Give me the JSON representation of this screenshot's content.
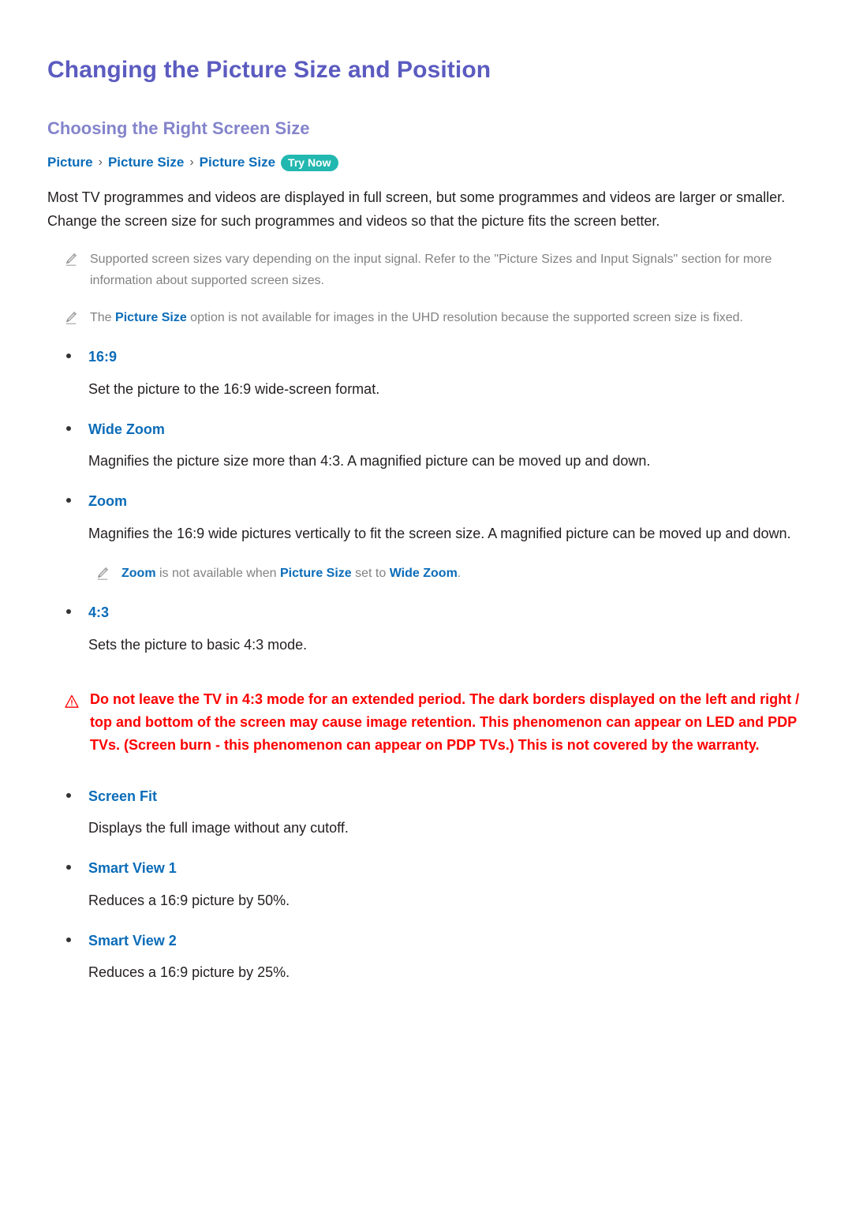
{
  "colors": {
    "title": "#5b5bc0",
    "section_title": "#8484cc",
    "link_blue": "#0b6cb8",
    "try_now_badge": "#22b8b0",
    "note_grey": "#828282",
    "caution_red": "#fe0000",
    "body_text": "#231f20"
  },
  "document": {
    "title": "Changing the Picture Size and Position",
    "section_title": "Choosing the Right Screen Size"
  },
  "breadcrumb": {
    "items": [
      "Picture",
      "Picture Size",
      "Picture Size"
    ],
    "separator": "›",
    "badge": "Try Now"
  },
  "intro": "Most TV programmes and videos are displayed in full screen, but some programmes and videos are larger or smaller. Change the screen size for such programmes and videos so that the picture fits the screen better.",
  "notes": [
    {
      "icon": "pencil-icon",
      "parts": [
        {
          "text": "Supported screen sizes vary depending on the input signal. Refer to the \"Picture Sizes and Input Signals\" section for more information about supported screen sizes.",
          "highlight": false
        }
      ]
    },
    {
      "icon": "pencil-icon",
      "parts": [
        {
          "text": "The ",
          "highlight": false
        },
        {
          "text": "Picture Size",
          "highlight": true
        },
        {
          "text": " option is not available for images in the UHD resolution because the supported screen size is fixed.",
          "highlight": false
        }
      ]
    }
  ],
  "options": [
    {
      "label": "16:9",
      "description": "Set the picture to the 16:9 wide-screen format."
    },
    {
      "label": "Wide Zoom",
      "description": "Magnifies the picture size more than 4:3. A magnified picture can be moved up and down."
    },
    {
      "label": "Zoom",
      "description": "Magnifies the 16:9 wide pictures vertically to fit the screen size. A magnified picture can be moved up and down.",
      "nested_note": {
        "icon": "pencil-icon",
        "parts": [
          {
            "text": "Zoom",
            "highlight": true
          },
          {
            "text": " is not available when ",
            "highlight": false
          },
          {
            "text": "Picture Size",
            "highlight": true
          },
          {
            "text": " set to ",
            "highlight": false
          },
          {
            "text": "Wide Zoom",
            "highlight": true
          },
          {
            "text": ".",
            "highlight": false
          }
        ]
      }
    },
    {
      "label": "4:3",
      "description": "Sets the picture to basic 4:3 mode."
    }
  ],
  "caution": {
    "icon": "warning-triangle-icon",
    "text": "Do not leave the TV in 4:3 mode for an extended period. The dark borders displayed on the left and right / top and bottom of the screen may cause image retention. This phenomenon can appear on LED and PDP TVs. (Screen burn - this phenomenon can appear on PDP TVs.) This is not covered by the warranty."
  },
  "options_after_caution": [
    {
      "label": "Screen Fit",
      "description": "Displays the full image without any cutoff."
    },
    {
      "label": "Smart View 1",
      "description": "Reduces a 16:9 picture by 50%."
    },
    {
      "label": "Smart View 2",
      "description": "Reduces a 16:9 picture by 25%."
    }
  ]
}
